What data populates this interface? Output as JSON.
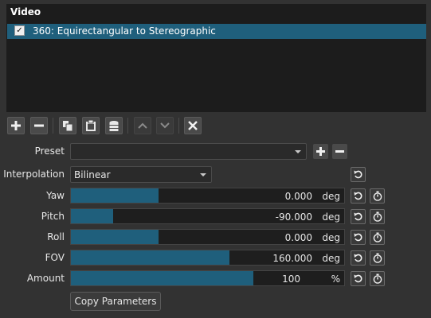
{
  "video_panel": {
    "title": "Video",
    "filters": [
      {
        "label": "360: Equirectangular to Stereographic",
        "checked": true,
        "check_glyph": "✓"
      }
    ]
  },
  "toolbar": {
    "icons": [
      "add-icon",
      "remove-icon",
      "copy-icon",
      "paste-icon",
      "save-preset-icon",
      "move-up-icon",
      "move-down-icon",
      "close-icon"
    ]
  },
  "preset": {
    "label": "Preset",
    "value": ""
  },
  "interpolation": {
    "label": "Interpolation",
    "value": "Bilinear"
  },
  "params": [
    {
      "key": "yaw",
      "label": "Yaw",
      "value": "0.000",
      "unit": "deg",
      "level": 0.32
    },
    {
      "key": "pitch",
      "label": "Pitch",
      "value": "-90.000",
      "unit": "deg",
      "level": 0.155
    },
    {
      "key": "roll",
      "label": "Roll",
      "value": "0.000",
      "unit": "deg",
      "level": 0.32
    },
    {
      "key": "fov",
      "label": "FOV",
      "value": "160.000",
      "unit": "deg",
      "level": 0.58
    },
    {
      "key": "amount",
      "label": "Amount",
      "value": "100",
      "unit": "%",
      "level": 0.667
    }
  ],
  "copy_parameters_label": "Copy Parameters",
  "colors": {
    "accent": "#1f5f7c",
    "background": "#323232",
    "panel": "#1c1c1c"
  }
}
